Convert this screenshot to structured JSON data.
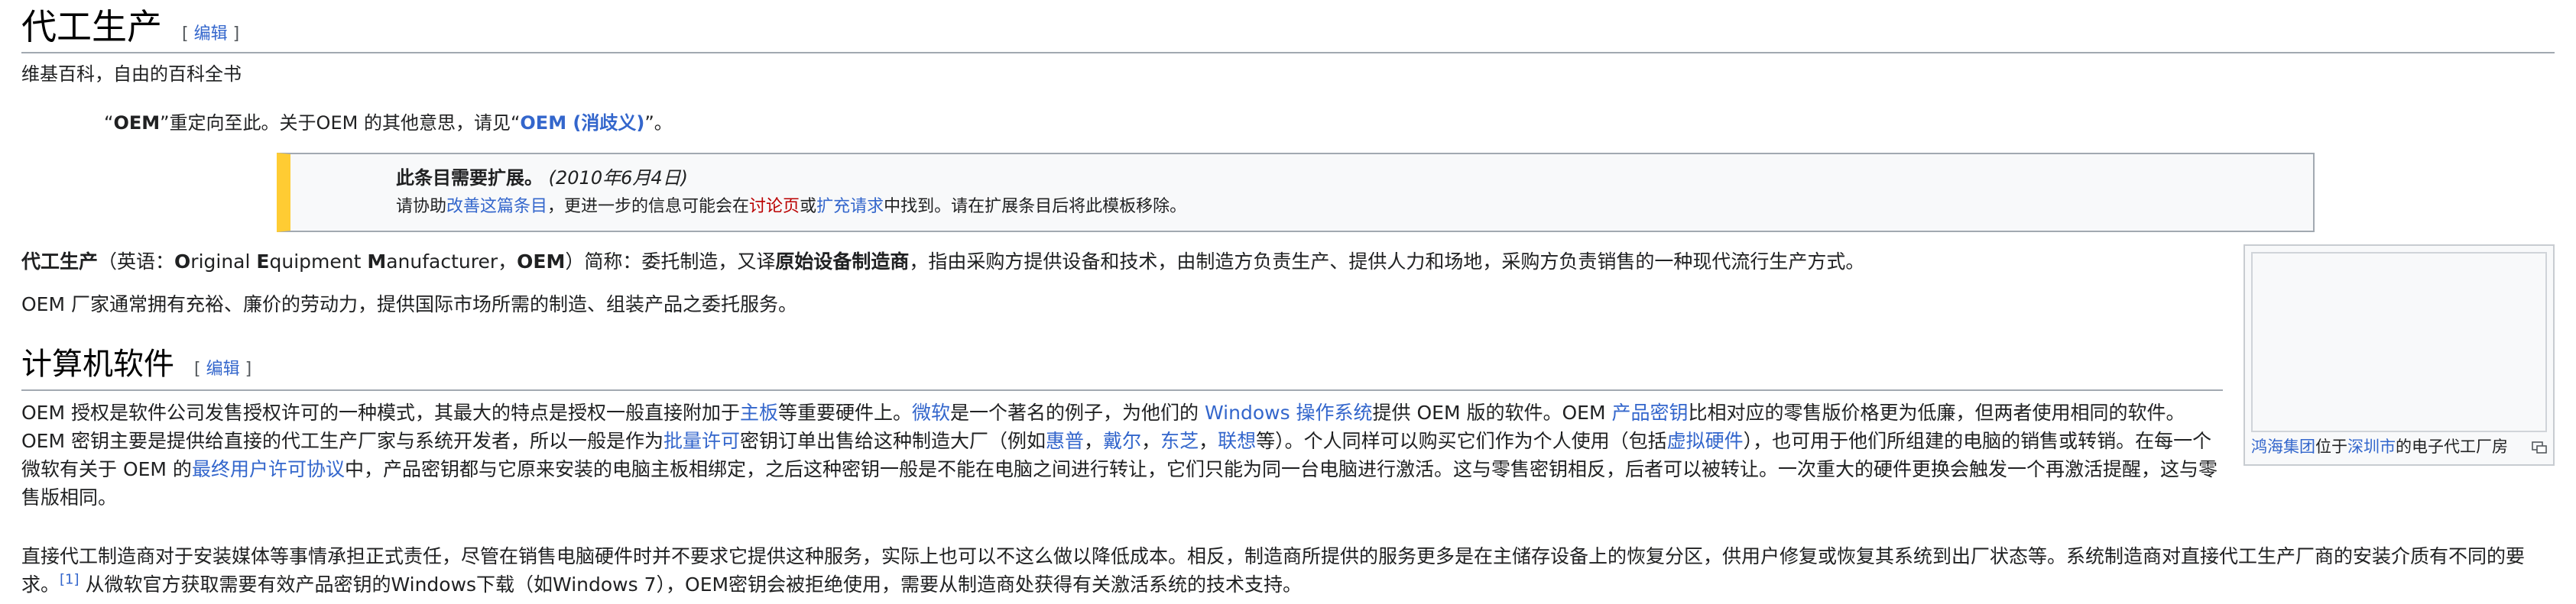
{
  "title": "代工生产",
  "edit_label": "编辑",
  "site_sub": "维基百科，自由的百科全书",
  "hatnote": {
    "q_open": "“",
    "term": "OEM",
    "q_close": "”",
    "mid": "重定向至此。关于OEM 的其他意思，请见“",
    "link": "OEM (消歧义)",
    "end": "”。"
  },
  "ambox": {
    "prefix": "此条目",
    "bold": "需要扩展",
    "suffix": "。",
    "date": "(2010年6月4日)",
    "l2_a": "请协助",
    "l2_link1": "改善这篇条目",
    "l2_b": "，更进一步的信息可能会在",
    "l2_link2": "讨论页",
    "l2_c": "或",
    "l2_link3": "扩充请求",
    "l2_d": "中找到。请在扩展条目后将此模板移除。"
  },
  "p1": {
    "term": "代工生产",
    "a": "（英语：",
    "o": "O",
    "o_rest": "riginal ",
    "e": "E",
    "e_rest": "quipment ",
    "m": "M",
    "m_rest": "anufacturer，",
    "abbr": "OEM",
    "b": "）简称：委托制造，又译",
    "term2": "原始设备制造商",
    "c": "，指由采购方提供设备和技术，由制造方负责生产、提供人力和场地，采购方负责销售的一种现代流行生产方式。"
  },
  "p2": "OEM 厂家通常拥有充裕、廉价的劳动力，提供国际市场所需的制造、组装产品之委托服务。",
  "section": "计算机软件",
  "p3": {
    "a": "OEM 授权是软件公司发售授权许可的一种模式，其最大的特点是授权一般直接附加于",
    "l_mainboard": "主板",
    "b": "等重要硬件上。",
    "l_microsoft": "微软",
    "c": "是一个著名的例子，为他们的 ",
    "l_windows": "Windows 操作系统",
    "d": "提供 OEM 版的软件。OEM ",
    "l_key": "产品密钥",
    "e": "比相对应的零售版价格更为低廉，但两者使用相同的软件。OEM 密钥主要是提供给直接的代工生产厂家与系统开发者，所以一般是作为",
    "l_volume": "批量许可",
    "f": "密钥订单出售给这种制造大厂（例如",
    "l_hp": "惠普",
    "g1": "，",
    "l_dell": "戴尔",
    "g2": "，",
    "l_toshiba": "东芝",
    "g3": "，",
    "l_lenovo": "联想",
    "h": "等）。个人同样可以购买它们作为个人使用（包括",
    "l_virtual": "虚拟硬件",
    "i": "），也可用于他们所组建的电脑的销售或转销。在每一个微软有关于 OEM 的",
    "l_eula": "最终用户许可协议",
    "j": "中，产品密钥都与它原来安装的电脑主板相绑定，之后这种密钥一般是不能在电脑之间进行转让，它们只能为同一台电脑进行激活。这与零售密钥相反，后者可以被转让。一次重大的硬件更换会触发一个再激活提醒，这与零售版相同。"
  },
  "p4": {
    "a": "直接代工制造商对于安装媒体等事情承担正式责任，尽管在销售电脑硬件时并不要求它提供这种服务，实际上也可以不这么做以降低成本。相反，制造商所提供的服务更多是在主储存设备上的恢复分区，供用户修复或恢复其系统到出厂状态等。系统制造商对直接代工生产厂商的安装介质有不同的要求。",
    "ref": "[1]",
    "b": " 从微软官方获取需要有效产品密钥的Windows下载（如Windows 7），OEM密钥会被拒绝使用，需要从制造商处获得有关激活系统的技术支持。"
  },
  "thumb": {
    "l_foxconn": "鸿海集团",
    "mid": "位于",
    "l_shenzhen": "深圳市",
    "end": "的电子代工厂房"
  }
}
